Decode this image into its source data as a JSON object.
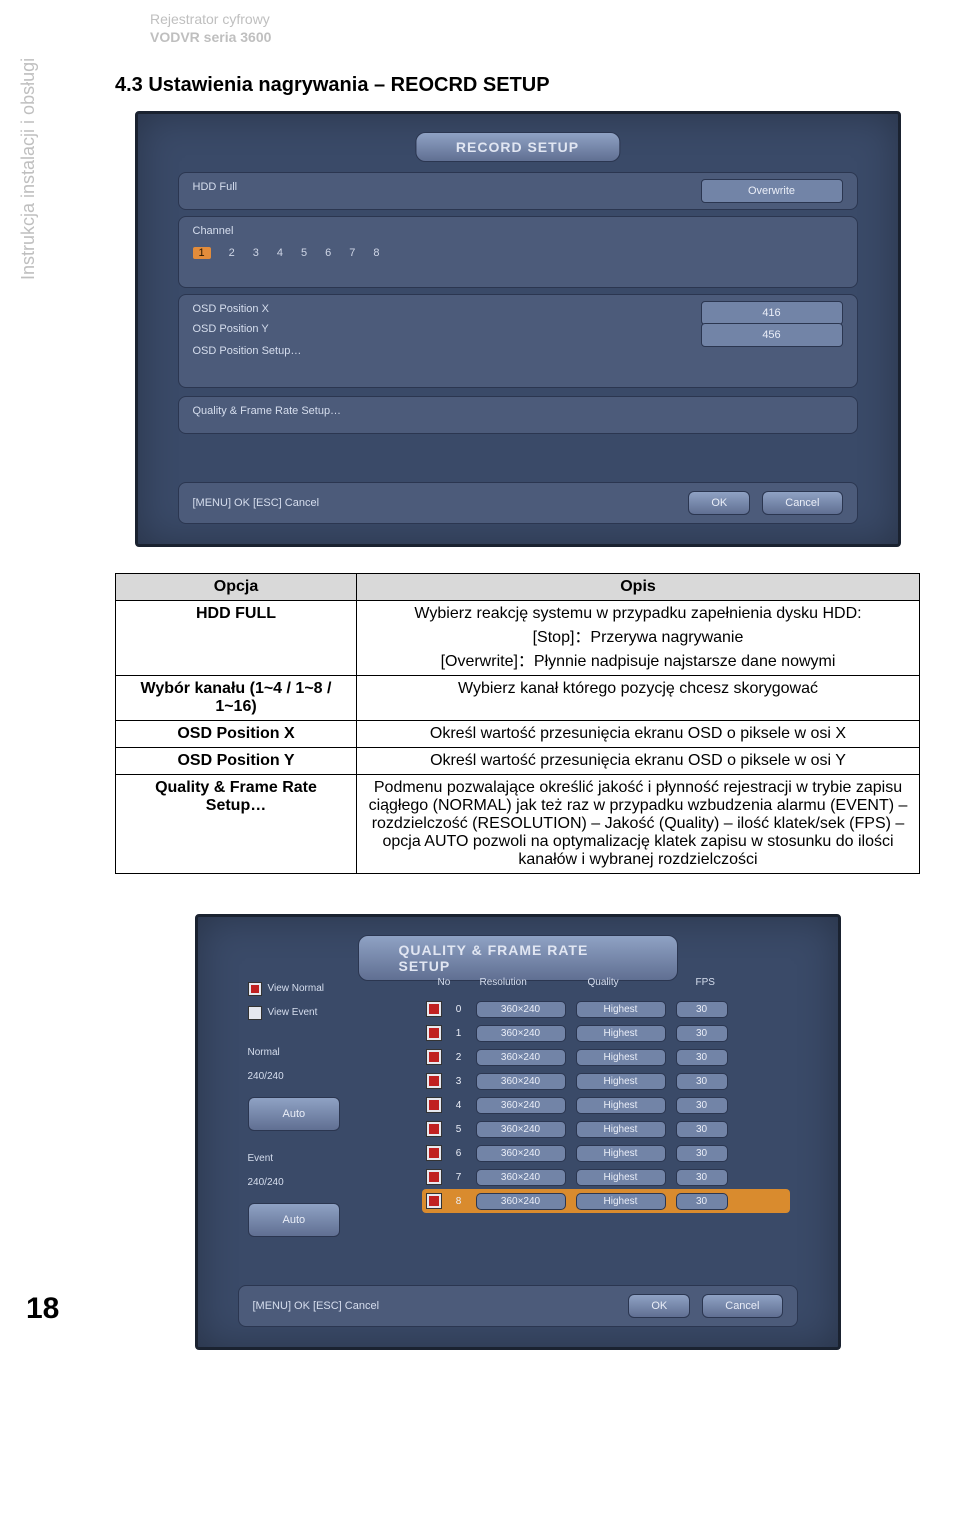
{
  "side_label": "Instrukcja instalacji i obsługi",
  "top_caption_line1": "Rejestrator cyfrowy",
  "top_caption_line2": "VODVR seria 3600",
  "section_title": "4.3   Ustawienia nagrywania – REOCRD SETUP",
  "page_number": "18",
  "screenshot1": {
    "title": "RECORD SETUP",
    "row_hdd_full_label": "HDD Full",
    "row_hdd_full_value": "Overwrite",
    "row_channel_label": "Channel",
    "channels": [
      "1",
      "2",
      "3",
      "4",
      "5",
      "6",
      "7",
      "8"
    ],
    "osd_x_label": "OSD Position X",
    "osd_x_value": "416",
    "osd_y_label": "OSD Position Y",
    "osd_y_value": "456",
    "osd_setup_label": "OSD Position Setup…",
    "qfr_label": "Quality & Frame Rate Setup…",
    "bottom_left": "[MENU] OK   [ESC] Cancel",
    "btn_ok": "OK",
    "btn_cancel": "Cancel"
  },
  "table": {
    "head_option": "Opcja",
    "head_desc": "Opis",
    "rows": [
      {
        "option": "HDD FULL",
        "desc_line1": "Wybierz reakcję systemu w przypadku zapełnienia dysku HDD:",
        "desc_line2": "[Stop]：Przerywa nagrywanie",
        "desc_line3": "[Overwrite]：Płynnie nadpisuje najstarsze dane nowymi"
      },
      {
        "option": "Wybór kanału (1~4 / 1~8 / 1~16)",
        "desc": "Wybierz kanał którego pozycję chcesz skorygować"
      },
      {
        "option": "OSD Position X",
        "desc": "Określ wartość przesunięcia ekranu OSD o piksele w osi X"
      },
      {
        "option": "OSD Position Y",
        "desc": "Określ wartość przesunięcia ekranu OSD o piksele w osi Y"
      },
      {
        "option": "Quality & Frame Rate Setup…",
        "desc": "Podmenu pozwalające określić jakość i płynność rejestracji w trybie zapisu ciągłego (NORMAL) jak też raz w przypadku wzbudzenia alarmu (EVENT) – rozdzielczość (RESOLUTION) – Jakość (Quality) – ilość klatek/sek (FPS) – opcja AUTO pozwoli na optymalizację klatek zapisu w stosunku do ilości kanałów i wybranej rozdzielczości"
      }
    ]
  },
  "screenshot2": {
    "title": "QUALITY & FRAME RATE SETUP",
    "view_normal": "View Normal",
    "view_event": "View Event",
    "normal_label": "Normal",
    "normal_fps": "240/240",
    "event_label": "Event",
    "event_fps": "240/240",
    "auto_btn": "Auto",
    "head_no": "No",
    "head_res": "Resolution",
    "head_quality": "Quality",
    "head_fps": "FPS",
    "rows": [
      {
        "no": "0",
        "res": "360×240",
        "q": "Highest",
        "fps": "30"
      },
      {
        "no": "1",
        "res": "360×240",
        "q": "Highest",
        "fps": "30"
      },
      {
        "no": "2",
        "res": "360×240",
        "q": "Highest",
        "fps": "30"
      },
      {
        "no": "3",
        "res": "360×240",
        "q": "Highest",
        "fps": "30"
      },
      {
        "no": "4",
        "res": "360×240",
        "q": "Highest",
        "fps": "30"
      },
      {
        "no": "5",
        "res": "360×240",
        "q": "Highest",
        "fps": "30"
      },
      {
        "no": "6",
        "res": "360×240",
        "q": "Highest",
        "fps": "30"
      },
      {
        "no": "7",
        "res": "360×240",
        "q": "Highest",
        "fps": "30"
      },
      {
        "no": "8",
        "res": "360×240",
        "q": "Highest",
        "fps": "30"
      }
    ],
    "bottom_left": "[MENU] OK   [ESC] Cancel",
    "btn_ok": "OK",
    "btn_cancel": "Cancel"
  }
}
